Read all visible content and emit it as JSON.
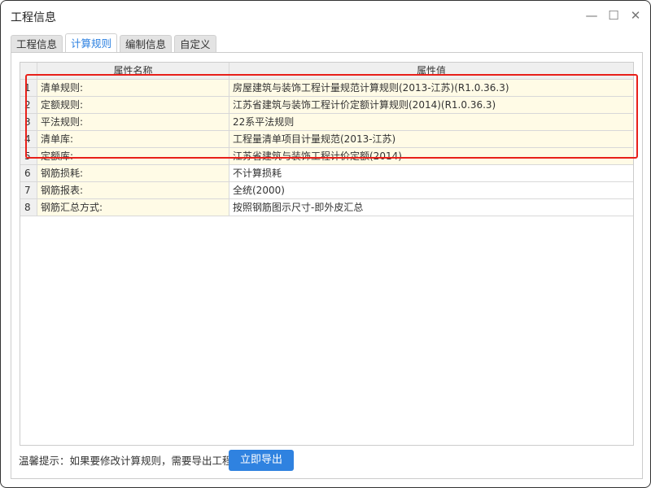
{
  "window": {
    "title": "工程信息",
    "minimize_icon": "minimize-icon",
    "maximize_icon": "maximize-icon",
    "close_icon": "close-icon"
  },
  "tabs": [
    {
      "label": "工程信息",
      "active": false
    },
    {
      "label": "计算规则",
      "active": true
    },
    {
      "label": "编制信息",
      "active": false
    },
    {
      "label": "自定义",
      "active": false
    }
  ],
  "table": {
    "columns": [
      "属性名称",
      "属性值"
    ],
    "rows": [
      {
        "num": "1",
        "name": "清单规则:",
        "value": "房屋建筑与装饰工程计量规范计算规则(2013-江苏)(R1.0.36.3)",
        "highlighted": true
      },
      {
        "num": "2",
        "name": "定额规则:",
        "value": "江苏省建筑与装饰工程计价定额计算规则(2014)(R1.0.36.3)",
        "highlighted": true
      },
      {
        "num": "3",
        "name": "平法规则:",
        "value": "22系平法规则",
        "highlighted": true
      },
      {
        "num": "4",
        "name": "清单库:",
        "value": "工程量清单项目计量规范(2013-江苏)",
        "highlighted": true
      },
      {
        "num": "5",
        "name": "定额库:",
        "value": "江苏省建筑与装饰工程计价定额(2014)",
        "highlighted": true
      },
      {
        "num": "6",
        "name": "钢筋损耗:",
        "value": "不计算损耗",
        "highlighted": false
      },
      {
        "num": "7",
        "name": "钢筋报表:",
        "value": "全统(2000)",
        "highlighted": false
      },
      {
        "num": "8",
        "name": "钢筋汇总方式:",
        "value": "按照钢筋图示尺寸-即外皮汇总",
        "highlighted": false
      }
    ]
  },
  "footer": {
    "hint": "温馨提示：如果要修改计算规则，需要导出工程",
    "export_button": "立即导出"
  },
  "colors": {
    "accent": "#2f82e0",
    "row_highlight": "#fffbe6",
    "annotation_box": "#e8201a"
  }
}
